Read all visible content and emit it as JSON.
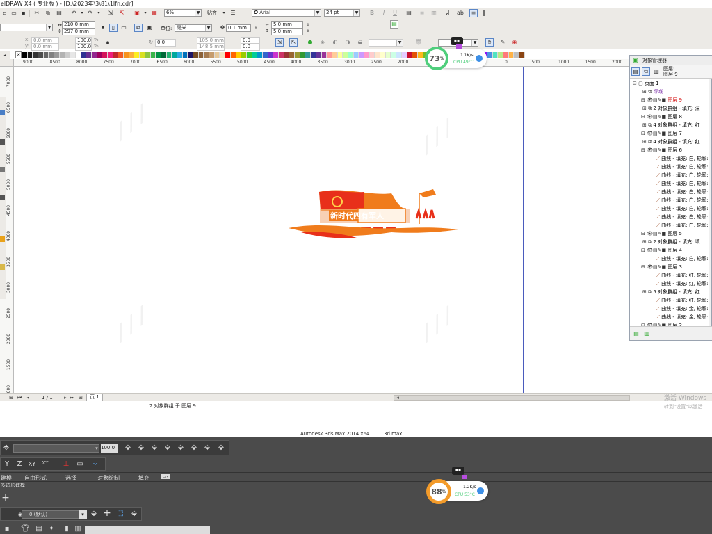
{
  "app": {
    "title": "elDRAW X4 ( 专业版 ) - [D:\\2023年\\3\\81\\1lfn.cdr]"
  },
  "toolbar_standard": {
    "zoom": "6%",
    "paste_label": "贴齐",
    "font_name": "Arial",
    "font_size": "24 pt"
  },
  "property_bar": {
    "left_x": "",
    "left_y": "5 mm",
    "width": "210.0 mm",
    "height": "297.0 mm",
    "units_label": "单位:",
    "units_value": "毫米",
    "nudge": "0.1 mm",
    "dup_x": "5.0 mm",
    "dup_y": "5.0 mm"
  },
  "transform_bar": {
    "pos_x": "0.0 mm",
    "pos_y": "0.0 mm",
    "scale_w": "100.0",
    "scale_h": "100.0",
    "scale_unit": "%",
    "angle": "0.0",
    "center_x": "105.0 mm",
    "center_y": "148.5 mm",
    "skew_x": "0.0",
    "skew_y": "0.0"
  },
  "ruler": {
    "h_labels": [
      "9000",
      "8500",
      "8000",
      "7500",
      "7000",
      "6500",
      "6000",
      "5500",
      "5000",
      "4500",
      "4000",
      "3500",
      "3000",
      "2500",
      "2000",
      "1500",
      "1000",
      "500",
      "0",
      "500",
      "1000",
      "1500",
      "2000",
      "2500"
    ],
    "v_labels": [
      "7000",
      "6500",
      "6000",
      "5500",
      "5000",
      "4500",
      "4000",
      "3500",
      "3000",
      "2500",
      "2000",
      "1500",
      "1000"
    ]
  },
  "artwork": {
    "slogan": "新时代四有军人"
  },
  "object_manager": {
    "title": "对象管理器",
    "layer_header_1": "图层:",
    "layer_header_2": "图层 9",
    "rows": [
      {
        "text": "页面 1",
        "indent": 0,
        "color": "#000"
      },
      {
        "text": "导线",
        "indent": 2,
        "color": "#7b2fa8"
      },
      {
        "text": "图层 9",
        "indent": 1,
        "color": "#d00000"
      },
      {
        "text": "2 对象群组 - 填充: 深",
        "indent": 2,
        "color": "#000"
      },
      {
        "text": "图层 8",
        "indent": 1,
        "color": "#000"
      },
      {
        "text": "4 对象群组 - 填充: 红",
        "indent": 2,
        "color": "#000"
      },
      {
        "text": "图层 7",
        "indent": 1,
        "color": "#000"
      },
      {
        "text": "4 对象群组 - 填充: 红",
        "indent": 2,
        "color": "#000"
      },
      {
        "text": "图层 6",
        "indent": 1,
        "color": "#000"
      },
      {
        "text": "曲线 - 填充: 白, 轮廓:",
        "indent": 3,
        "color": "#000"
      },
      {
        "text": "曲线 - 填充: 白, 轮廓:",
        "indent": 3,
        "color": "#000"
      },
      {
        "text": "曲线 - 填充: 白, 轮廓:",
        "indent": 3,
        "color": "#000"
      },
      {
        "text": "曲线 - 填充: 白, 轮廓:",
        "indent": 3,
        "color": "#000"
      },
      {
        "text": "曲线 - 填充: 白, 轮廓:",
        "indent": 3,
        "color": "#000"
      },
      {
        "text": "曲线 - 填充: 白, 轮廓:",
        "indent": 3,
        "color": "#000"
      },
      {
        "text": "曲线 - 填充: 白, 轮廓:",
        "indent": 3,
        "color": "#000"
      },
      {
        "text": "曲线 - 填充: 白, 轮廓:",
        "indent": 3,
        "color": "#000"
      },
      {
        "text": "曲线 - 填充: 白, 轮廓:",
        "indent": 3,
        "color": "#000"
      },
      {
        "text": "图层 5",
        "indent": 1,
        "color": "#000"
      },
      {
        "text": "2 对象群组 - 填充: 填",
        "indent": 2,
        "color": "#000"
      },
      {
        "text": "图层 4",
        "indent": 1,
        "color": "#000"
      },
      {
        "text": "曲线 - 填充: 白, 轮廓:",
        "indent": 3,
        "color": "#000"
      },
      {
        "text": "图层 3",
        "indent": 1,
        "color": "#000"
      },
      {
        "text": "曲线 - 填充: 红, 轮廓:",
        "indent": 3,
        "color": "#000"
      },
      {
        "text": "曲线 - 填充: 红, 轮廓:",
        "indent": 3,
        "color": "#000"
      },
      {
        "text": "5 对象群组 - 填充: 红",
        "indent": 2,
        "color": "#000"
      },
      {
        "text": "曲线 - 填充: 红, 轮廓:",
        "indent": 3,
        "color": "#000"
      },
      {
        "text": "曲线 - 填充: 金, 轮廓:",
        "indent": 3,
        "color": "#000"
      },
      {
        "text": "曲线 - 填充: 金, 轮廓:",
        "indent": 3,
        "color": "#000"
      },
      {
        "text": "图层 2",
        "indent": 1,
        "color": "#000"
      }
    ]
  },
  "page_nav": {
    "page_count": "1 / 1",
    "page_tab": "页 1"
  },
  "status": {
    "selection": "2 对象群组 于 图层 9"
  },
  "activate": {
    "line1": "激活 Windows",
    "line2": "转到\"设置\"以激活"
  },
  "monitor_top": {
    "percent": "73",
    "unit": "%",
    "net": "1.1K/s",
    "cpu": "CPU 49°C"
  },
  "monitor_bottom": {
    "percent": "88",
    "unit": "%",
    "net": "1.2K/s",
    "cpu": "CPU 53°C"
  },
  "max": {
    "title": "Autodesk 3ds Max  2014 x64",
    "file": "3d.max",
    "dropdown_value": "",
    "count_value": "100.0",
    "axes": [
      "Y",
      "Z",
      "XY",
      "XY"
    ],
    "tabs": [
      "建模",
      "自由形式",
      "选择",
      "对象绘制",
      "填充"
    ],
    "create_label": "多边形建模",
    "layer_value": "0 (默认)"
  },
  "colors": {
    "accent_orange": "#f07c1c",
    "party_red": "#e8301a",
    "gauge_green": "#4fce7c",
    "gauge_orange": "#f39b2a",
    "guide_blue": "#4a5bbd"
  }
}
